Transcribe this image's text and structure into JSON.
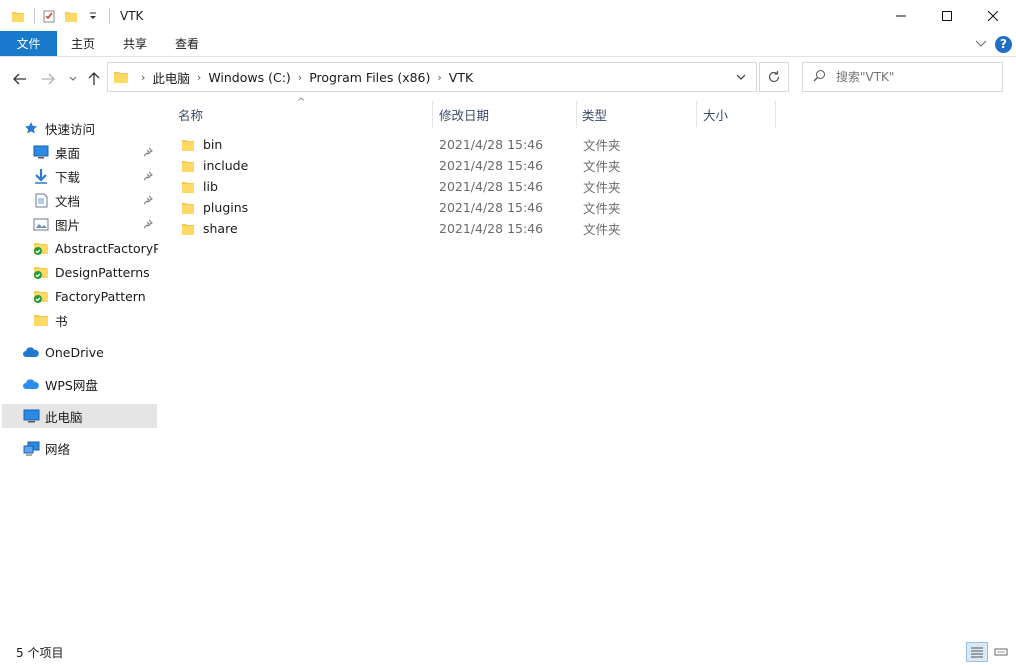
{
  "window": {
    "title": "VTK",
    "colors": {
      "accent": "#1979ca",
      "folder": "#f3c94f",
      "selected": "#e5e5e5"
    }
  },
  "ribbon": {
    "tabs": [
      {
        "label": "文件"
      },
      {
        "label": "主页"
      },
      {
        "label": "共享"
      },
      {
        "label": "查看"
      }
    ],
    "help_label": "?"
  },
  "address": {
    "crumbs": [
      {
        "label": "此电脑"
      },
      {
        "label": "Windows (C:)"
      },
      {
        "label": "Program Files (x86)"
      },
      {
        "label": "VTK"
      }
    ]
  },
  "search": {
    "placeholder": "搜索\"VTK\""
  },
  "sidebar": {
    "items": [
      {
        "label": "快速访问",
        "icon": "star-icon"
      },
      {
        "label": "桌面",
        "icon": "desktop-icon",
        "pinned": true
      },
      {
        "label": "下载",
        "icon": "download-icon",
        "pinned": true
      },
      {
        "label": "文档",
        "icon": "document-icon",
        "pinned": true
      },
      {
        "label": "图片",
        "icon": "picture-icon",
        "pinned": true
      },
      {
        "label": "AbstractFactoryPa",
        "icon": "synced-folder-icon"
      },
      {
        "label": "DesignPatterns",
        "icon": "synced-folder-icon"
      },
      {
        "label": "FactoryPattern",
        "icon": "synced-folder-icon"
      },
      {
        "label": "书",
        "icon": "folder-icon"
      },
      {
        "label": "OneDrive",
        "icon": "cloud-icon"
      },
      {
        "label": "WPS网盘",
        "icon": "cloud-icon"
      },
      {
        "label": "此电脑",
        "icon": "computer-icon",
        "selected": true
      },
      {
        "label": "网络",
        "icon": "network-icon"
      }
    ]
  },
  "columns": {
    "name": "名称",
    "date": "修改日期",
    "type": "类型",
    "size": "大小"
  },
  "files": [
    {
      "name": "bin",
      "date": "2021/4/28 15:46",
      "type": "文件夹"
    },
    {
      "name": "include",
      "date": "2021/4/28 15:46",
      "type": "文件夹"
    },
    {
      "name": "lib",
      "date": "2021/4/28 15:46",
      "type": "文件夹"
    },
    {
      "name": "plugins",
      "date": "2021/4/28 15:46",
      "type": "文件夹"
    },
    {
      "name": "share",
      "date": "2021/4/28 15:46",
      "type": "文件夹"
    }
  ],
  "status": {
    "count_text": "5 个项目"
  }
}
